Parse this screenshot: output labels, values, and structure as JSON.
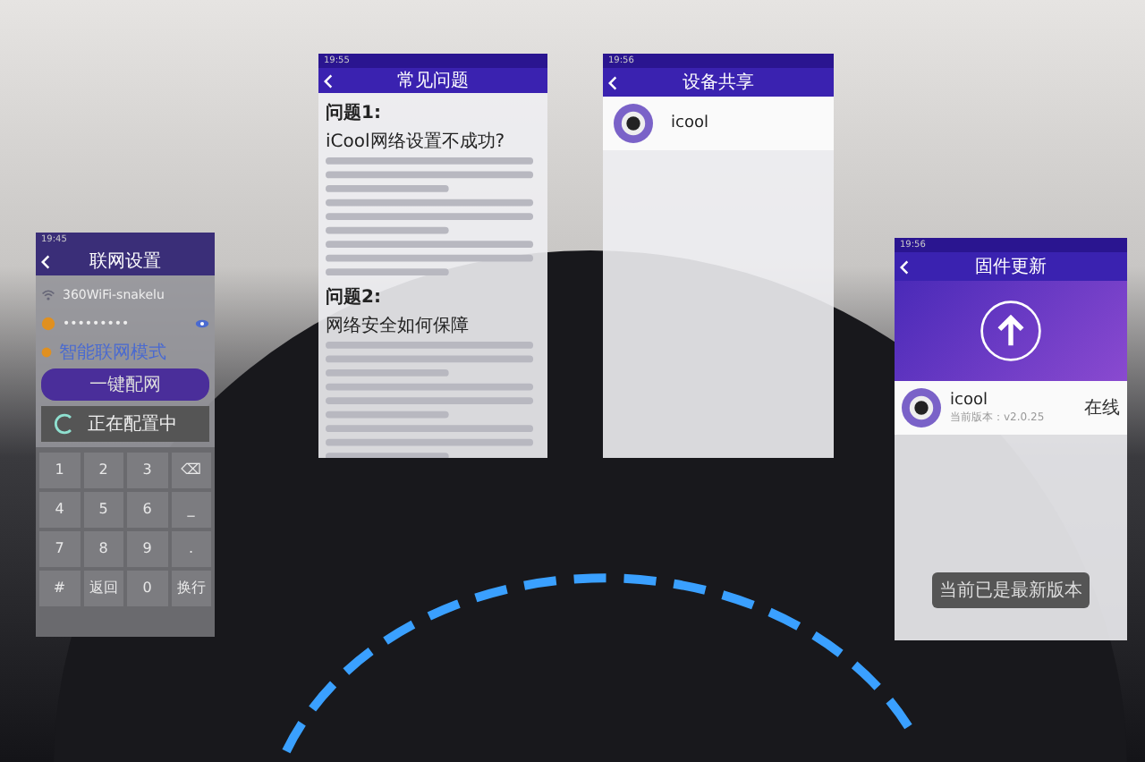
{
  "network_setup": {
    "time": "19:45",
    "title": "联网设置",
    "ssid": "360WiFi-snakelu",
    "password": "•••••••••",
    "mode_link": "智能联网模式",
    "connect_button": "一键配网",
    "dialog": "正在配置中",
    "keys": [
      [
        "1",
        "2",
        "3",
        "⌫"
      ],
      [
        "4",
        "5",
        "6",
        "_"
      ],
      [
        "7",
        "8",
        "9",
        "."
      ],
      [
        "#",
        "返回",
        "0",
        "换行"
      ]
    ]
  },
  "faq": {
    "time": "19:55",
    "title": "常见问题",
    "sections": [
      {
        "heading": "问题1:",
        "question": "iCool网络设置不成功?"
      },
      {
        "heading": "问题2:",
        "question": "网络安全如何保障"
      }
    ]
  },
  "device_share": {
    "time": "19:56",
    "title": "设备共享",
    "device": "icool"
  },
  "firmware_update": {
    "time": "19:56",
    "title": "固件更新",
    "device": "icool",
    "version": "当前版本：v2.0.25",
    "status": "在线",
    "toast": "当前已是最新版本"
  }
}
